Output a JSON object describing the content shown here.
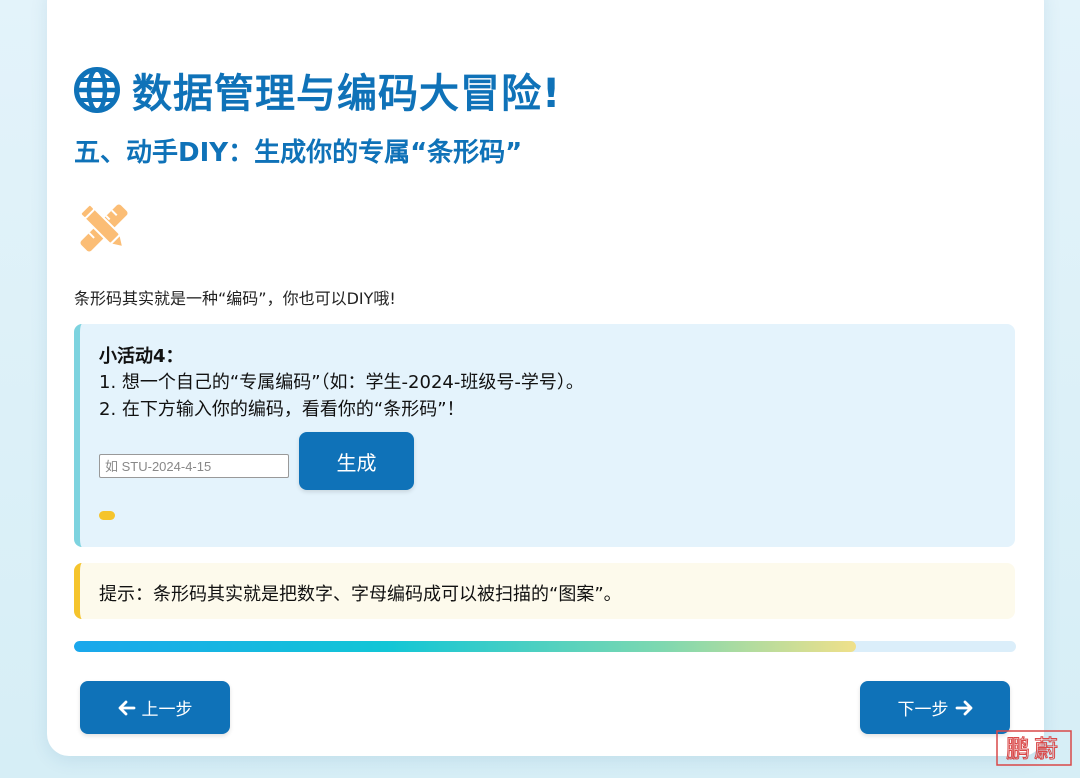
{
  "header": {
    "title": "数据管理与编码大冒险!",
    "title_icon": "globe-icon",
    "subtitle": "五、动手DIY：生成你的专属“条形码”"
  },
  "section": {
    "icon": "pencil-ruler-icon",
    "intro": "条形码其实就是一种“编码”，你也可以DIY哦!"
  },
  "activity": {
    "title": "小活动4：",
    "line1": "1. 想一个自己的“专属编码”（如：学生-2024-班级号-学号）。",
    "line2": "2. 在下方输入你的编码，看看你的“条形码”！",
    "input_value": "",
    "input_placeholder": "如 STU-2024-4-15",
    "generate_label": "生成"
  },
  "tip": {
    "text": "提示：条形码其实就是把数字、字母编码成可以被扫描的“图案”。"
  },
  "progress": {
    "fraction": 0.83
  },
  "nav": {
    "prev_label": "上一步",
    "next_label": "下一步"
  },
  "watermark_text": "鹏蔚",
  "colors": {
    "primary": "#0f72b8",
    "accent_yellow": "#f5c42c",
    "activity_bg": "#e4f3fc",
    "tip_bg": "#fdfaec",
    "icon_orange": "#fbbd75"
  }
}
